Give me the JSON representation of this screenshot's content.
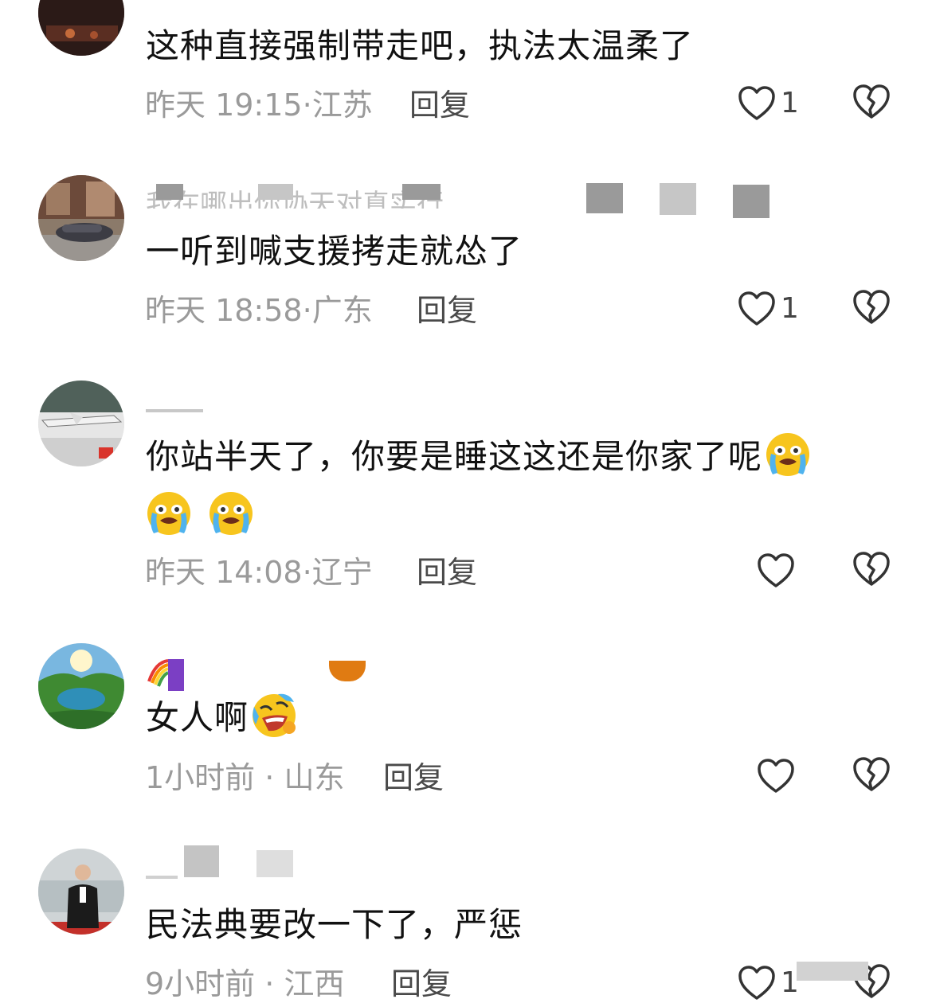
{
  "colors": {
    "background": "#ffffff",
    "text": "#111111",
    "meta": "#9a9a9a",
    "reply": "#4a4a4a",
    "icon_stroke": "#333333"
  },
  "icons": {
    "like": "heart-outline-icon",
    "dislike": "broken-heart-icon",
    "crying_emoji": "loudly-crying-face-emoji",
    "laughing_emoji": "rolling-laughing-face-emoji"
  },
  "comments": [
    {
      "text": "这种直接强制带走吧，执法太温柔了",
      "time": "昨天 19:15",
      "location": "江苏",
      "reply_label": "回复",
      "likes": "1"
    },
    {
      "username_fragment": "我在哪出你协天对真实行",
      "text": "一听到喊支援拷走就怂了",
      "time": "昨天 18:58",
      "location": "广东",
      "reply_label": "回复",
      "likes": "1"
    },
    {
      "text": "你站半天了，你要是睡这这还是你家了呢",
      "time": "昨天 14:08",
      "location": "辽宁",
      "reply_label": "回复",
      "likes": ""
    },
    {
      "text": "女人啊",
      "time": "1小时前",
      "location": "山东",
      "reply_label": "回复",
      "likes": ""
    },
    {
      "text": "民法典要改一下了，严惩",
      "time": "9小时前",
      "location": "江西",
      "reply_label": "回复",
      "likes": "1"
    }
  ]
}
